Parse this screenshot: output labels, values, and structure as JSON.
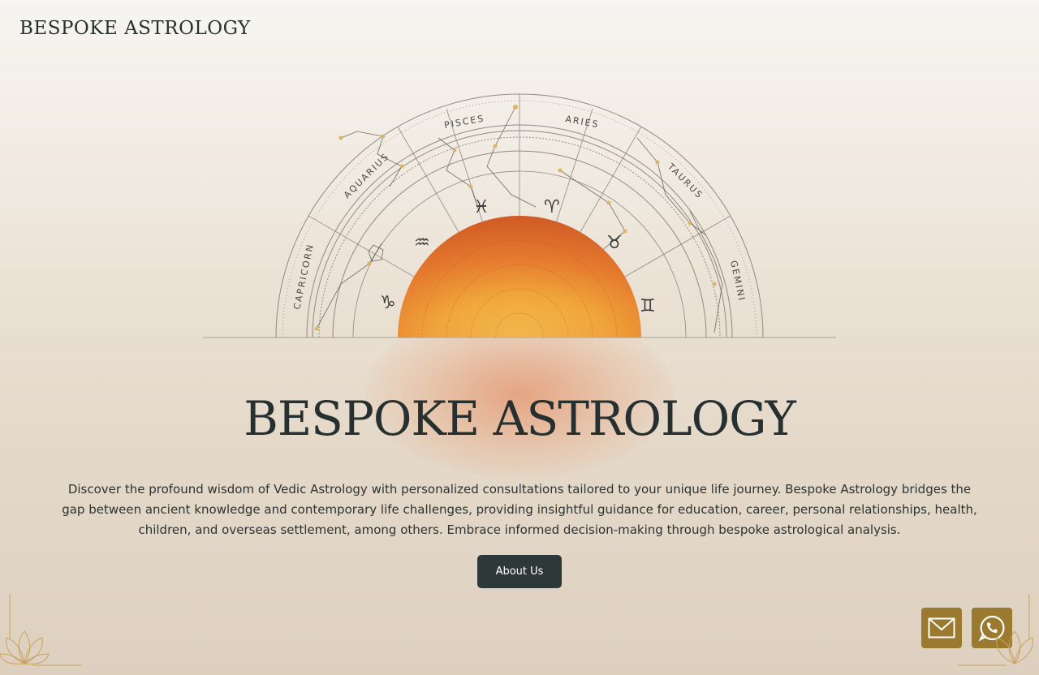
{
  "header": {
    "brand": "BESPOKE ASTROLOGY"
  },
  "hero": {
    "signs": [
      "PISCES",
      "ARIES",
      "AQUARIUS",
      "TAURUS",
      "CAPRICORN",
      "GEMINI"
    ],
    "symbols": [
      "♓",
      "♈",
      "♒",
      "♉",
      "♑",
      "♊"
    ],
    "title": "BESPOKE ASTROLOGY",
    "description": "Discover the profound wisdom of Vedic Astrology with personalized consultations tailored to your unique life journey. Bespoke Astrology bridges the gap between ancient knowledge and contemporary life challenges, providing insightful guidance for education, career, personal relationships, health, children, and overseas settlement, among others. Embrace informed decision-making through bespoke astrological analysis.",
    "cta_label": "About Us"
  },
  "contact": {
    "email_icon": "envelope-icon",
    "whatsapp_icon": "whatsapp-icon"
  },
  "colors": {
    "accent_gold": "#9b7a2f",
    "button_dark": "#2f3838",
    "text_dark": "#263030",
    "sun_orange": "#e06a2a"
  }
}
